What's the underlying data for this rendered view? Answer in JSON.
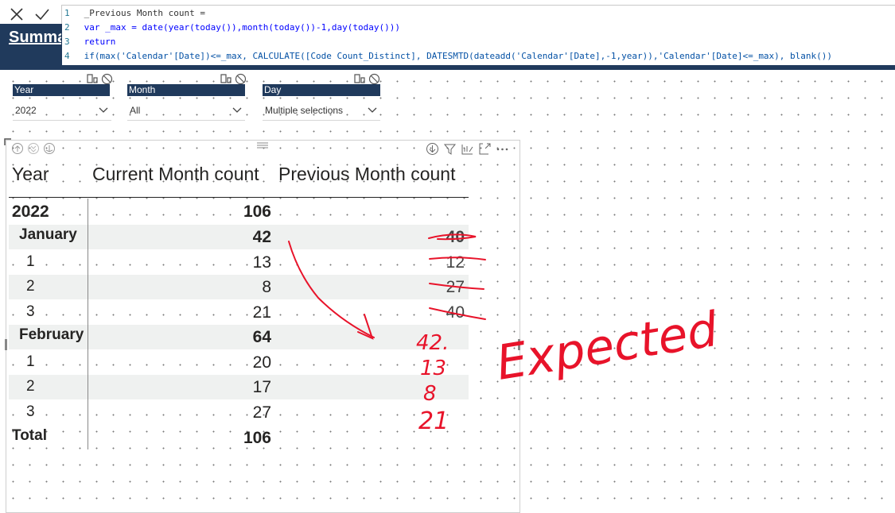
{
  "formula_bar": {
    "cancel_glyph": "✕",
    "commit_glyph": "✓",
    "lines": [
      {
        "num": "1",
        "text": "_Previous Month count ="
      },
      {
        "num": "2",
        "text": "var _max = date(year(today()),month(today())-1,day(today()))"
      },
      {
        "num": "3",
        "text": "return"
      },
      {
        "num": "4",
        "text": "if(max('Calendar'[Date])<=_max, CALCULATE([Code Count_Distinct], DATESMTD(dateadd('Calendar'[Date],-1,year)),'Calendar'[Date]<=_max), blank())"
      }
    ]
  },
  "page_title": "Summary",
  "slicers": [
    {
      "header": "Year",
      "value": "2022"
    },
    {
      "header": "Month",
      "value": "All"
    },
    {
      "header": "Day",
      "value": "Multiple selections"
    }
  ],
  "matrix": {
    "columns": [
      "Year",
      "Current Month count",
      "Previous Month count"
    ],
    "rows": [
      {
        "label": "2022",
        "current": "106",
        "previous": "",
        "level": 0
      },
      {
        "label": "January",
        "current": "42",
        "previous": "40",
        "level": 1
      },
      {
        "label": "1",
        "current": "13",
        "previous": "12",
        "level": 2
      },
      {
        "label": "2",
        "current": "8",
        "previous": "27",
        "level": 2
      },
      {
        "label": "3",
        "current": "21",
        "previous": "40",
        "level": 2
      },
      {
        "label": "February",
        "current": "64",
        "previous": "",
        "level": 1
      },
      {
        "label": "1",
        "current": "20",
        "previous": "",
        "level": 2
      },
      {
        "label": "2",
        "current": "17",
        "previous": "",
        "level": 2
      },
      {
        "label": "3",
        "current": "27",
        "previous": "",
        "level": 2
      },
      {
        "label": "Total",
        "current": "106",
        "previous": "",
        "level": 0
      }
    ]
  },
  "annotation": {
    "word": "Expected",
    "values": [
      "42.",
      "13",
      "8",
      "21"
    ],
    "color": "#e8132a"
  },
  "colors": {
    "header_band": "#203a5c",
    "row_shade": "#eff1f0"
  }
}
